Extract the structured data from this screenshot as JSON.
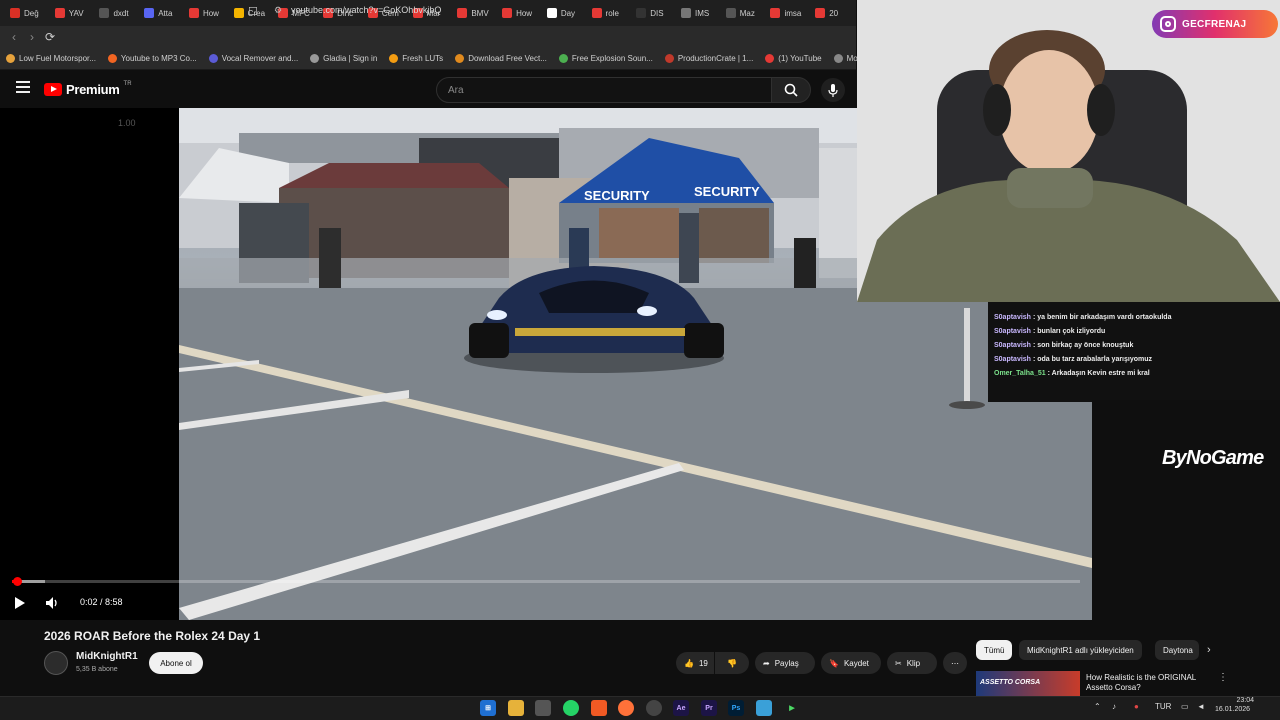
{
  "tabs": [
    "Değ",
    "YAV",
    "dxdt",
    "Atta",
    "How",
    "Crea",
    "MFC",
    "Dinc",
    "Cem",
    "Mar",
    "BMV",
    "How",
    "Day",
    "role",
    "DIS",
    "IMS",
    "Maz",
    "imsa",
    "20"
  ],
  "address_bar": {
    "url": "youtube.com/watch?v=GoKOhbvkjbQ"
  },
  "bookmarks": [
    "Low Fuel Motorspor...",
    "Youtube to MP3 Co...",
    "Vocal Remover and...",
    "Gladia | Sign in",
    "Fresh LUTs",
    "Download Free Vect...",
    "Free Explosion Soun...",
    "ProductionCrate | 1...",
    "(1) YouTube",
    "Moi"
  ],
  "youtube_header": {
    "logo_text": "Premium",
    "logo_region": "TR",
    "search_placeholder": "Ara"
  },
  "player": {
    "speed_hint": "1.00",
    "time_display": "0:02 / 8:58",
    "progress_fraction": 0.0037,
    "buffered_fraction": 0.0309
  },
  "video_scene": {
    "canopy_left_label": "SECURITY",
    "canopy_right_label": "SECURITY"
  },
  "overlay": {
    "instagram_handle": "GECFRENAJ",
    "sponsor_logo": "ByNoGame"
  },
  "chat": [
    {
      "user": "S0aptavish",
      "text": ": ya benim bir arkadaşım vardı ortaokulda"
    },
    {
      "user": "S0aptavish",
      "text": ": bunları çok izliyordu"
    },
    {
      "user": "S0aptavish",
      "text": ": son birkaç ay önce knouştuk"
    },
    {
      "user": "S0aptavish",
      "text": ": oda bu tarz arabalarla yarışıyomuz"
    },
    {
      "user": "Omer_Talha_51",
      "text": ": Arkadaşın Kevin estre mi kral"
    }
  ],
  "video_info": {
    "title": "2026 ROAR Before the Rolex 24 Day 1",
    "channel": "MidKnightR1",
    "subscribers": "5,35 B abone",
    "subscribe_label": "Abone ol",
    "like_count": "19",
    "share_label": "Paylaş",
    "save_label": "Kaydet",
    "clip_label": "Klip"
  },
  "filter_chips": [
    "Tümü",
    "MidKnightR1 adlı yükleyiciden",
    "Daytona"
  ],
  "recommendation": {
    "thumb_text": "ASSETTO CORSA",
    "title": "How Realistic is the ORIGINAL Assetto Corsa?"
  },
  "taskbar": {
    "language": "TUR",
    "time": "23:04",
    "date": "16.01.2026",
    "apps": [
      "windows",
      "file-explorer",
      "notepad",
      "whatsapp",
      "brave",
      "firefox",
      "chrome",
      "after-effects",
      "premiere",
      "photoshop",
      "notes",
      "media"
    ]
  },
  "colors": {
    "accent_red": "#ff0000",
    "background": "#0f0f0f",
    "instagram_gradient": "#e1306c"
  }
}
